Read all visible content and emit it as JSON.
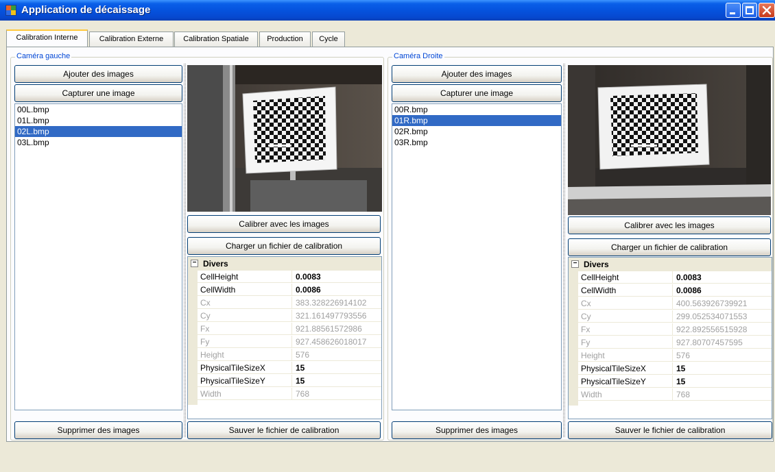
{
  "window": {
    "title": "Application de décaissage",
    "icon": "app-window-icon",
    "minimize_icon": "minimize-icon",
    "maximize_icon": "maximize-icon",
    "close_icon": "close-icon"
  },
  "tabs": [
    {
      "label": "Calibration Interne",
      "active": true
    },
    {
      "label": "Calibration Externe",
      "active": false
    },
    {
      "label": "Calibration Spatiale",
      "active": false
    },
    {
      "label": "Production",
      "active": false
    },
    {
      "label": "Cycle",
      "active": false
    }
  ],
  "left_camera": {
    "group_title": "Caméra gauche",
    "add_images_label": "Ajouter des images",
    "capture_image_label": "Capturer une image",
    "images": [
      "00L.bmp",
      "01L.bmp",
      "02L.bmp",
      "03L.bmp"
    ],
    "selected_index": 2,
    "calibrate_label": "Calibrer avec les images",
    "load_calibration_label": "Charger un fichier de calibration",
    "delete_images_label": "Supprimer des images",
    "save_calibration_label": "Sauver le fichier de calibration",
    "properties": {
      "category": "Divers",
      "rows": [
        {
          "name": "CellHeight",
          "value": "0.0083",
          "readonly": false
        },
        {
          "name": "CellWidth",
          "value": "0.0086",
          "readonly": false
        },
        {
          "name": "Cx",
          "value": "383.328226914102",
          "readonly": true
        },
        {
          "name": "Cy",
          "value": "321.161497793556",
          "readonly": true
        },
        {
          "name": "Fx",
          "value": "921.88561572986",
          "readonly": true
        },
        {
          "name": "Fy",
          "value": "927.458626018017",
          "readonly": true
        },
        {
          "name": "Height",
          "value": "576",
          "readonly": true
        },
        {
          "name": "PhysicalTileSizeX",
          "value": "15",
          "readonly": false
        },
        {
          "name": "PhysicalTileSizeY",
          "value": "15",
          "readonly": false
        },
        {
          "name": "Width",
          "value": "768",
          "readonly": true
        }
      ]
    }
  },
  "right_camera": {
    "group_title": "Caméra Droite",
    "add_images_label": "Ajouter des images",
    "capture_image_label": "Capturer une image",
    "images": [
      "00R.bmp",
      "01R.bmp",
      "02R.bmp",
      "03R.bmp"
    ],
    "selected_index": 1,
    "calibrate_label": "Calibrer avec les images",
    "load_calibration_label": "Charger un fichier de calibration",
    "delete_images_label": "Supprimer des images",
    "save_calibration_label": "Sauver le fichier de calibration",
    "properties": {
      "category": "Divers",
      "rows": [
        {
          "name": "CellHeight",
          "value": "0.0083",
          "readonly": false
        },
        {
          "name": "CellWidth",
          "value": "0.0086",
          "readonly": false
        },
        {
          "name": "Cx",
          "value": "400.563926739921",
          "readonly": true
        },
        {
          "name": "Cy",
          "value": "299.052534071553",
          "readonly": true
        },
        {
          "name": "Fx",
          "value": "922.892556515928",
          "readonly": true
        },
        {
          "name": "Fy",
          "value": "927.80707457595",
          "readonly": true
        },
        {
          "name": "Height",
          "value": "576",
          "readonly": true
        },
        {
          "name": "PhysicalTileSizeX",
          "value": "15",
          "readonly": false
        },
        {
          "name": "PhysicalTileSizeY",
          "value": "15",
          "readonly": false
        },
        {
          "name": "Width",
          "value": "768",
          "readonly": true
        }
      ]
    }
  },
  "colors": {
    "titlebar": "#0553DE",
    "selection": "#316AC5",
    "group_title": "#0046D5",
    "window_bg": "#ECE9D8"
  }
}
